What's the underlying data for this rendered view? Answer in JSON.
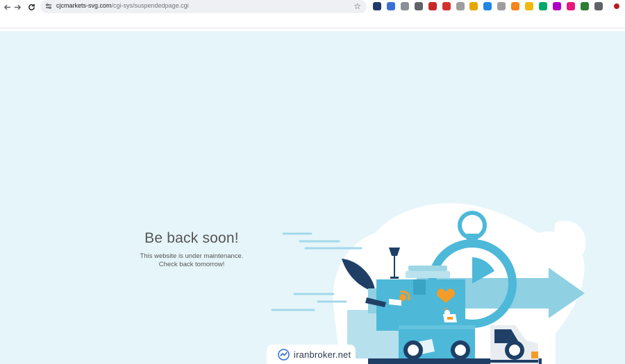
{
  "browser": {
    "url_host": "cjcmarkets-svg.com",
    "url_path": "/cgi-sys/suspendedpage.cgi",
    "nav": [
      "back-icon",
      "forward-icon",
      "reload-icon"
    ],
    "bookmark_icon": "star-icon",
    "extensions": [
      {
        "name": "ext-1-icon",
        "color": "#1f3a6b"
      },
      {
        "name": "ext-2-icon",
        "color": "#3b6fd8"
      },
      {
        "name": "ext-3-icon",
        "color": "#8a8f98"
      },
      {
        "name": "ext-4-icon",
        "color": "#5f6368"
      },
      {
        "name": "ext-5-icon",
        "color": "#c62828"
      },
      {
        "name": "ext-6-icon",
        "color": "#d32f2f"
      },
      {
        "name": "ext-7-icon",
        "color": "#9e9e9e"
      },
      {
        "name": "ext-8-icon",
        "color": "#e6a700"
      },
      {
        "name": "ext-9-icon",
        "color": "#1e88e5"
      },
      {
        "name": "ext-10-icon",
        "color": "#9e9e9e"
      },
      {
        "name": "ext-11-icon",
        "color": "#f6851b"
      },
      {
        "name": "ext-12-icon",
        "color": "#f0b90b"
      },
      {
        "name": "ext-13-icon",
        "color": "#00a86b"
      },
      {
        "name": "ext-14-icon",
        "color": "#b000c8"
      },
      {
        "name": "ext-15-icon",
        "color": "#e5197d"
      },
      {
        "name": "ext-16-icon",
        "color": "#2e7d32"
      },
      {
        "name": "extensions-puzzle-icon",
        "color": "#5f6368"
      },
      {
        "name": "profile-icon",
        "color": "#b71c1c"
      }
    ]
  },
  "page": {
    "title": "Be back soon!",
    "line1": "This website is under maintenance.",
    "line2": "Check back tomorrow!",
    "background": "#e6f5fa"
  },
  "watermark": {
    "text": "iranbroker.net",
    "icon": "trend-chart-icon"
  },
  "illustration": {
    "name": "moving-truck-illustration",
    "colors": {
      "primary": "#4db8d8",
      "light": "#9fd6e6",
      "dark": "#1f3f66",
      "accent": "#f39c2a",
      "white": "#ffffff"
    }
  }
}
